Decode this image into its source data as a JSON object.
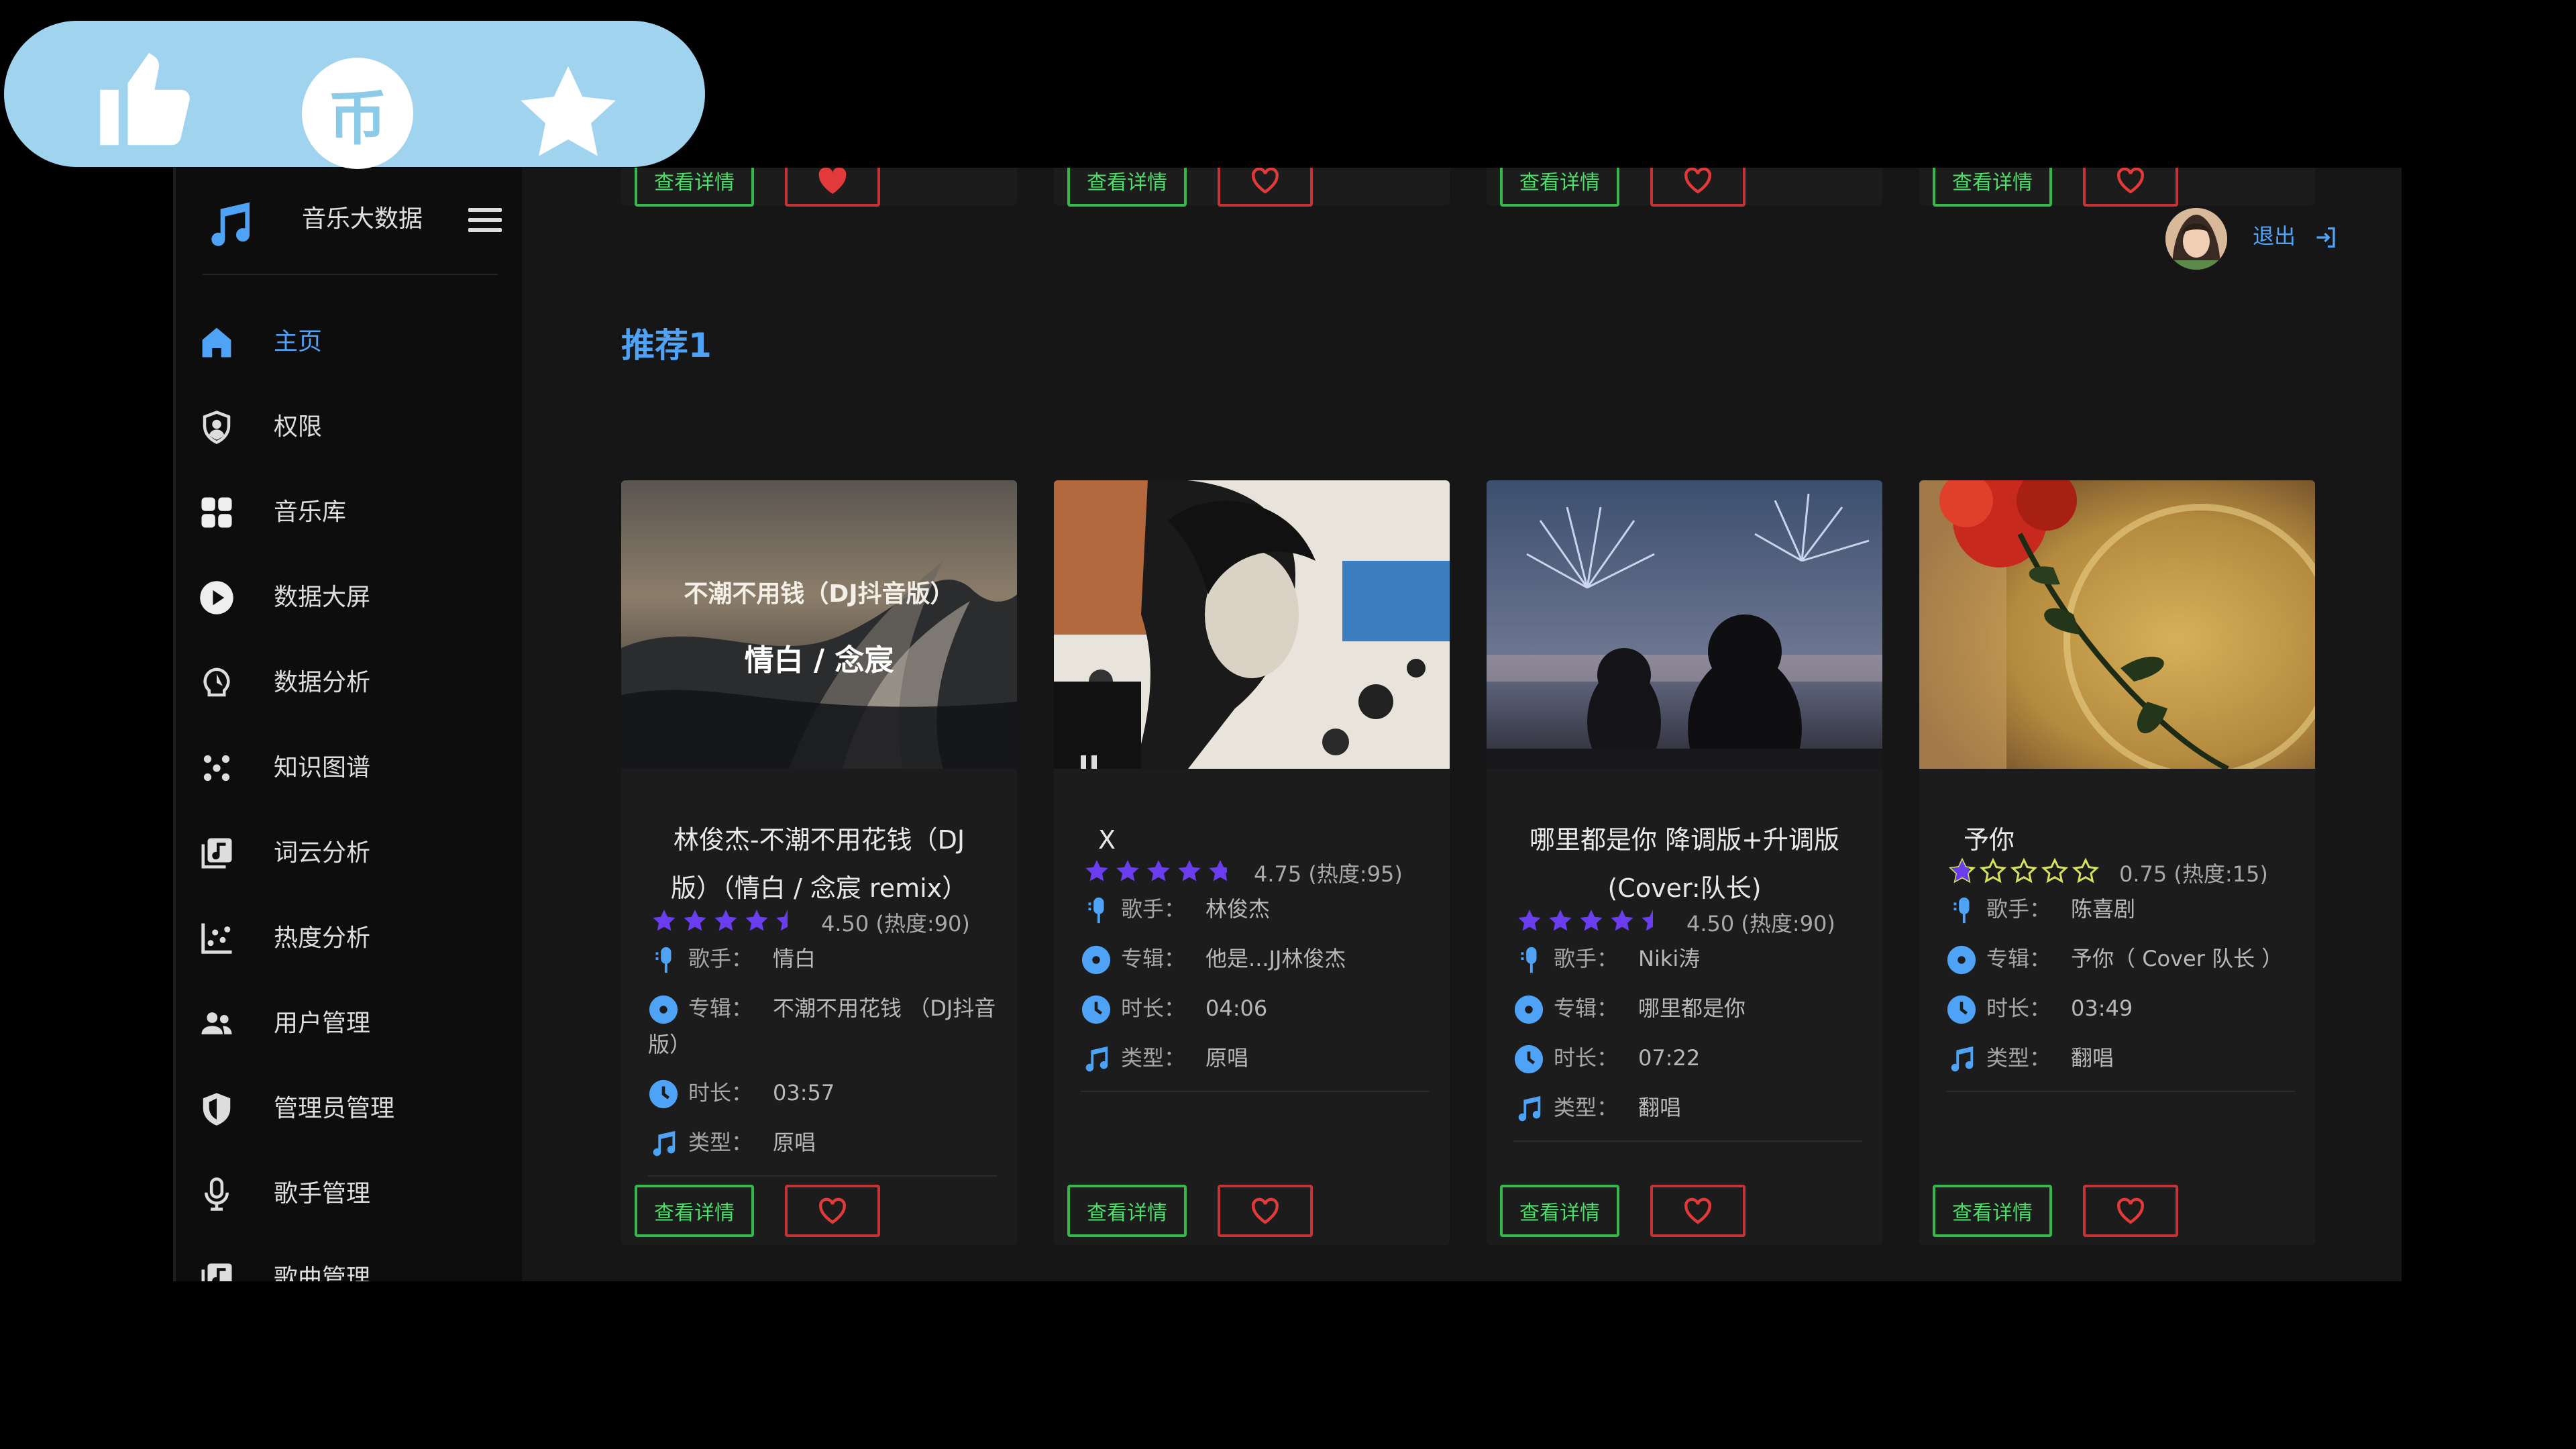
{
  "header": {
    "app_name": "音乐大数据",
    "logout": "退出"
  },
  "sidebar": {
    "items": [
      {
        "label": "主页",
        "icon": "home-icon",
        "active": true
      },
      {
        "label": "权限",
        "icon": "user-shield-icon"
      },
      {
        "label": "音乐库",
        "icon": "grid-icon"
      },
      {
        "label": "数据大屏",
        "icon": "play-circle-icon"
      },
      {
        "label": "数据分析",
        "icon": "analysis-icon"
      },
      {
        "label": "知识图谱",
        "icon": "graph-dots-icon"
      },
      {
        "label": "词云分析",
        "icon": "wordcloud-icon"
      },
      {
        "label": "热度分析",
        "icon": "scatter-chart-icon"
      },
      {
        "label": "用户管理",
        "icon": "users-icon"
      },
      {
        "label": "管理员管理",
        "icon": "shield-icon"
      },
      {
        "label": "歌手管理",
        "icon": "microphone-icon"
      },
      {
        "label": "歌曲管理",
        "icon": "music-file-icon"
      }
    ]
  },
  "section_title": "推荐1",
  "detail_button": "查看详情",
  "labels": {
    "singer": "歌手：",
    "album": "专辑：",
    "duration": "时长：",
    "type": "类型："
  },
  "colors": {
    "accent": "#4fa3f7",
    "detail_green": "#35b84c",
    "like_red": "#c53434",
    "star_purple": "#6a3df0"
  },
  "cards": [
    {
      "title": "林俊杰-不潮不用花钱（DJ版）（情白 / 念宸 remix）",
      "title_lines": [
        "林俊杰-不潮不用花钱（DJ",
        "版）（情白 / 念宸 remix）"
      ],
      "cover_text": {
        "line1": "不潮不用钱（DJ抖音版）",
        "line2": "情白 / 念宸"
      },
      "rating": 4.5,
      "score": "4.50 (热度:90)",
      "singer": "情白",
      "album_lines": [
        "不潮不用花钱 （DJ抖音",
        "版）"
      ],
      "duration": "03:57",
      "type": "原唱",
      "top_liked": true
    },
    {
      "title": "X",
      "title_lines": [
        "X"
      ],
      "rating": 4.75,
      "score": "4.75 (热度:95)",
      "singer": "林俊杰",
      "album_lines": [
        "他是...JJ林俊杰"
      ],
      "duration": "04:06",
      "type": "原唱",
      "top_liked": false
    },
    {
      "title": "哪里都是你 降调版+升调版(Cover:队长)",
      "title_lines": [
        "哪里都是你 降调版+升调版",
        "(Cover:队长)"
      ],
      "rating": 4.5,
      "score": "4.50 (热度:90)",
      "singer": "Niki涛",
      "album_lines": [
        "哪里都是你"
      ],
      "duration": "07:22",
      "type": "翻唱",
      "top_liked": false
    },
    {
      "title": "予你",
      "title_lines": [
        "予你"
      ],
      "rating": 0.75,
      "score": "0.75 (热度:15)",
      "singer": "陈喜剧",
      "album_lines": [
        "予你（ Cover 队长 ）"
      ],
      "duration": "03:49",
      "type": "翻唱",
      "top_liked": false
    }
  ]
}
